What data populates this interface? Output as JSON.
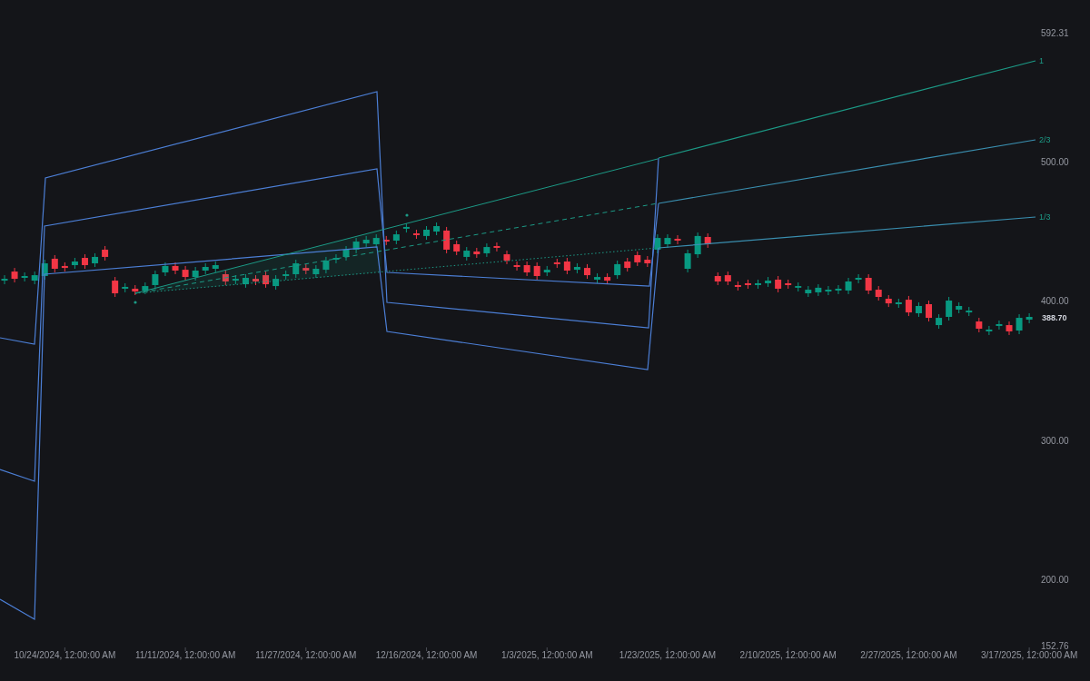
{
  "chart_data": {
    "type": "candlestick",
    "categories": [
      null,
      null,
      null,
      null,
      null,
      null,
      "10/24/2024, 12:00:00 AM",
      null,
      null,
      null,
      null,
      null,
      null,
      null,
      null,
      null,
      null,
      null,
      "11/11/2024, 12:00:00 AM",
      null,
      null,
      null,
      null,
      null,
      null,
      null,
      null,
      null,
      null,
      null,
      "11/27/2024, 12:00:00 AM",
      null,
      null,
      null,
      null,
      null,
      null,
      null,
      null,
      null,
      null,
      null,
      "12/16/2024, 12:00:00 AM",
      null,
      null,
      null,
      null,
      null,
      null,
      null,
      null,
      null,
      null,
      null,
      "1/3/2025, 12:00:00 AM",
      null,
      null,
      null,
      null,
      null,
      null,
      null,
      null,
      null,
      null,
      null,
      "1/23/2025, 12:00:00 AM",
      null,
      null,
      null,
      null,
      null,
      null,
      null,
      null,
      null,
      null,
      null,
      "2/10/2025, 12:00:00 AM",
      null,
      null,
      null,
      null,
      null,
      null,
      null,
      null,
      null,
      null,
      null,
      "2/27/2025, 12:00:00 AM",
      null,
      null,
      null,
      null,
      null,
      null,
      null,
      null,
      null,
      null,
      null,
      "3/17/2025, 12:00:00 AM"
    ],
    "ohlc": [
      [
        414.5,
        418.4,
        411.9,
        415.8
      ],
      [
        421.0,
        423.6,
        413.2,
        415.8
      ],
      [
        416.5,
        420.4,
        413.9,
        417.8
      ],
      [
        414.5,
        421.0,
        411.9,
        418.4
      ],
      [
        417.8,
        429.5,
        415.2,
        426.9
      ],
      [
        430.2,
        432.8,
        420.4,
        423.0
      ],
      [
        425.0,
        427.6,
        421.0,
        423.6
      ],
      [
        425.6,
        430.8,
        423.0,
        428.2
      ],
      [
        430.8,
        433.4,
        423.0,
        425.6
      ],
      [
        426.9,
        434.1,
        424.3,
        431.5
      ],
      [
        436.7,
        439.3,
        428.9,
        431.5
      ],
      [
        414.5,
        417.1,
        402.8,
        405.4
      ],
      [
        408.7,
        412.6,
        406.1,
        410.0
      ],
      [
        408.7,
        411.3,
        404.1,
        406.7
      ],
      [
        407.4,
        413.2,
        404.8,
        410.6
      ],
      [
        411.3,
        421.7,
        408.7,
        419.1
      ],
      [
        420.4,
        427.6,
        417.8,
        425.0
      ],
      [
        425.0,
        427.6,
        419.1,
        421.7
      ],
      [
        422.3,
        425.0,
        414.5,
        417.1
      ],
      [
        417.1,
        424.3,
        414.5,
        421.7
      ],
      [
        421.7,
        426.9,
        419.1,
        424.3
      ],
      [
        423.0,
        428.2,
        420.4,
        425.6
      ],
      [
        419.1,
        421.7,
        411.3,
        413.9
      ],
      [
        414.5,
        418.4,
        411.9,
        415.8
      ],
      [
        411.9,
        419.1,
        409.4,
        416.5
      ],
      [
        415.8,
        418.4,
        411.3,
        413.9
      ],
      [
        418.4,
        421.0,
        409.4,
        411.9
      ],
      [
        410.6,
        418.4,
        408.0,
        415.8
      ],
      [
        417.8,
        421.7,
        415.2,
        419.1
      ],
      [
        419.1,
        429.5,
        416.5,
        426.9
      ],
      [
        423.6,
        426.3,
        419.1,
        421.7
      ],
      [
        419.1,
        425.6,
        416.5,
        423.0
      ],
      [
        422.3,
        431.5,
        419.7,
        428.9
      ],
      [
        429.5,
        433.4,
        426.9,
        430.8
      ],
      [
        431.5,
        439.3,
        428.9,
        436.7
      ],
      [
        436.7,
        445.1,
        434.1,
        442.5
      ],
      [
        441.2,
        446.5,
        438.6,
        443.8
      ],
      [
        440.6,
        447.7,
        438.0,
        445.1
      ],
      [
        443.8,
        446.5,
        440.0,
        442.5
      ],
      [
        443.2,
        450.4,
        440.6,
        447.7
      ],
      [
        451.7,
        455.5,
        449.0,
        453.0
      ],
      [
        448.4,
        451.0,
        444.5,
        447.1
      ],
      [
        446.5,
        453.6,
        443.8,
        451.0
      ],
      [
        449.7,
        456.2,
        447.1,
        453.6
      ],
      [
        450.4,
        453.0,
        434.1,
        436.7
      ],
      [
        440.6,
        443.2,
        432.8,
        435.4
      ],
      [
        431.5,
        438.6,
        428.9,
        436.0
      ],
      [
        435.4,
        438.0,
        430.8,
        433.4
      ],
      [
        434.1,
        441.2,
        431.5,
        438.6
      ],
      [
        439.3,
        441.9,
        435.4,
        438.0
      ],
      [
        433.4,
        436.0,
        426.3,
        428.9
      ],
      [
        425.6,
        428.2,
        421.7,
        424.3
      ],
      [
        425.6,
        428.2,
        417.8,
        420.4
      ],
      [
        425.0,
        427.6,
        415.2,
        417.8
      ],
      [
        420.4,
        425.0,
        417.8,
        422.3
      ],
      [
        427.6,
        430.2,
        423.6,
        426.3
      ],
      [
        428.2,
        430.8,
        419.1,
        421.7
      ],
      [
        422.3,
        426.9,
        419.7,
        424.3
      ],
      [
        423.6,
        426.3,
        415.8,
        418.4
      ],
      [
        415.2,
        419.7,
        412.6,
        417.1
      ],
      [
        417.1,
        419.7,
        411.9,
        414.5
      ],
      [
        418.4,
        428.9,
        415.8,
        426.3
      ],
      [
        428.2,
        430.8,
        421.0,
        423.6
      ],
      [
        432.8,
        435.4,
        425.0,
        427.6
      ],
      [
        429.5,
        432.1,
        424.3,
        426.9
      ],
      [
        436.7,
        447.7,
        434.1,
        445.1
      ],
      [
        440.6,
        447.7,
        438.0,
        445.1
      ],
      [
        444.5,
        447.1,
        440.6,
        443.2
      ],
      [
        423.0,
        436.7,
        420.4,
        434.1
      ],
      [
        433.4,
        449.0,
        430.8,
        446.5
      ],
      [
        445.8,
        448.4,
        438.0,
        440.6
      ],
      [
        417.8,
        420.4,
        411.3,
        413.9
      ],
      [
        418.4,
        421.0,
        411.3,
        413.9
      ],
      [
        411.3,
        413.9,
        407.4,
        410.0
      ],
      [
        412.6,
        415.2,
        408.7,
        411.3
      ],
      [
        411.3,
        415.2,
        408.7,
        412.6
      ],
      [
        412.6,
        417.1,
        410.0,
        414.5
      ],
      [
        415.2,
        417.8,
        406.1,
        408.7
      ],
      [
        412.6,
        415.2,
        408.7,
        411.3
      ],
      [
        409.4,
        413.2,
        406.7,
        410.6
      ],
      [
        405.4,
        410.6,
        402.8,
        408.0
      ],
      [
        406.1,
        411.9,
        403.5,
        409.4
      ],
      [
        406.7,
        410.6,
        404.1,
        408.0
      ],
      [
        407.4,
        411.3,
        404.8,
        408.7
      ],
      [
        407.4,
        416.5,
        404.8,
        413.9
      ],
      [
        415.2,
        419.1,
        412.6,
        416.5
      ],
      [
        416.5,
        419.1,
        404.8,
        407.4
      ],
      [
        408.0,
        410.6,
        400.2,
        402.8
      ],
      [
        401.5,
        404.1,
        395.6,
        398.2
      ],
      [
        397.6,
        401.5,
        395.0,
        398.9
      ],
      [
        400.8,
        403.5,
        389.1,
        391.7
      ],
      [
        391.1,
        398.9,
        388.5,
        396.3
      ],
      [
        397.6,
        400.2,
        385.2,
        387.8
      ],
      [
        382.6,
        390.4,
        380.0,
        387.8
      ],
      [
        388.5,
        402.8,
        385.9,
        400.2
      ],
      [
        393.7,
        398.9,
        391.1,
        396.3
      ],
      [
        391.7,
        395.6,
        389.1,
        393.0
      ],
      [
        385.2,
        387.8,
        377.4,
        380.0
      ],
      [
        378.1,
        382.0,
        375.5,
        379.4
      ],
      [
        382.0,
        385.9,
        379.4,
        383.3
      ],
      [
        382.6,
        385.2,
        375.5,
        378.1
      ],
      [
        378.7,
        390.4,
        376.1,
        387.8
      ],
      [
        386.5,
        391.1,
        383.9,
        388.5
      ]
    ],
    "ylim": [
      152.76,
      592.31
    ],
    "yticks": [
      {
        "value": 592.31,
        "label": "592.31"
      },
      {
        "value": 500,
        "label": "500.00"
      },
      {
        "value": 400,
        "label": "400.00"
      },
      {
        "value": 300,
        "label": "300.00"
      },
      {
        "value": 200,
        "label": "200.00"
      },
      {
        "value": 152.76,
        "label": "152.76"
      }
    ]
  },
  "last_price": "388.70",
  "fan_levels": [
    "1",
    "2/3",
    "1/3"
  ]
}
